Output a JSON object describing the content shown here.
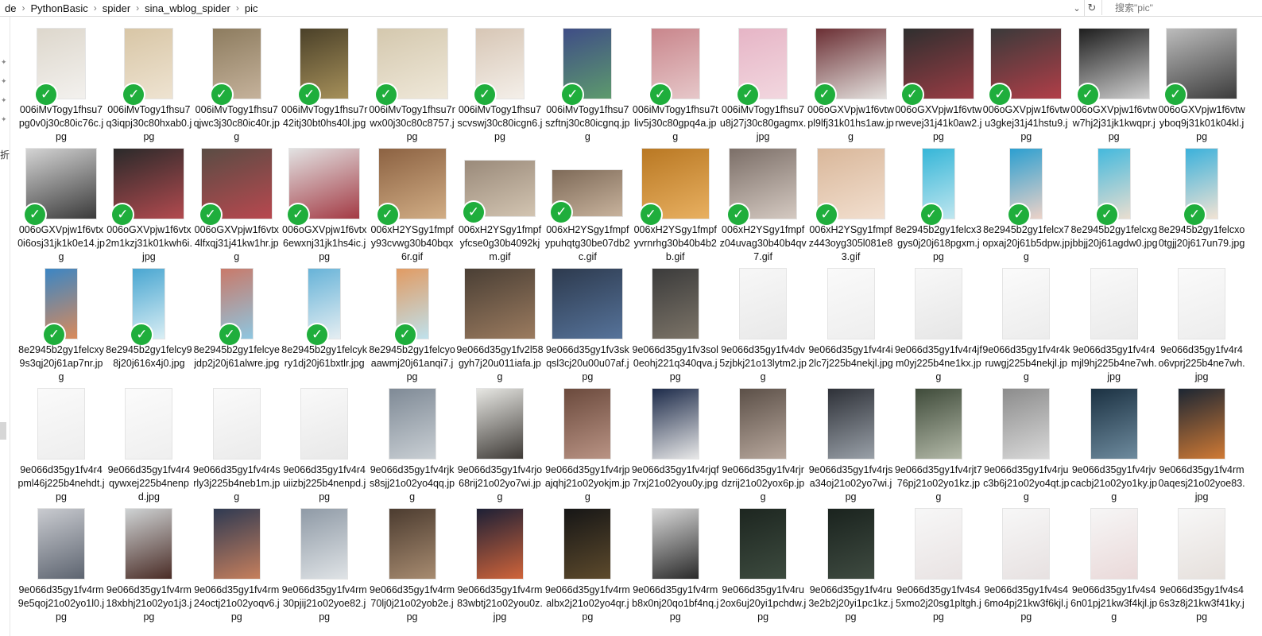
{
  "address": {
    "crumbs": [
      "de",
      "PythonBasic",
      "spider",
      "sina_wblog_spider",
      "pic"
    ],
    "separator": "›",
    "dropdown_glyph": "⌄",
    "refresh_glyph": "↻",
    "search_placeholder": "搜索\"pic\""
  },
  "left_pane": {
    "text": "折"
  },
  "files": [
    {
      "name": "006iMvTogy1fhsu7pg0v0j30c80ic76c.jpg",
      "checked": true,
      "colors": [
        "#ddd7cc",
        "#f3f1ee"
      ]
    },
    {
      "name": "006iMvTogy1fhsu7q3iqpj30c80hxab0.jpg",
      "checked": true,
      "colors": [
        "#d8c6a6",
        "#eee3d1"
      ]
    },
    {
      "name": "006iMvTogy1fhsu7qjwc3j30c80ic40r.jpg",
      "checked": true,
      "colors": [
        "#8d7c5f",
        "#c5b29b"
      ]
    },
    {
      "name": "006iMvTogy1fhsu7r42itj30bt0hs40l.jpg",
      "checked": true,
      "colors": [
        "#4b4129",
        "#a6905a"
      ]
    },
    {
      "name": "006iMvTogy1fhsu7rwx00j30c80c8757.jpg",
      "checked": true,
      "colors": [
        "#d4c8ae",
        "#efe8d9"
      ]
    },
    {
      "name": "006iMvTogy1fhsu7scvswj30c80icgn6.jpg",
      "checked": true,
      "colors": [
        "#d7c6b5",
        "#f4efe9"
      ]
    },
    {
      "name": "006iMvTogy1fhsu7szftnj30c80icgnq.jpg",
      "checked": true,
      "colors": [
        "#3f4d86",
        "#5d9a6d"
      ]
    },
    {
      "name": "006iMvTogy1fhsu7tliv5j30c80gpq4a.jpg",
      "checked": true,
      "colors": [
        "#c9868c",
        "#e6c7c9"
      ]
    },
    {
      "name": "006iMvTogy1fhsu7u8j27j30c80gagmx.jpg",
      "checked": true,
      "colors": [
        "#e6b5c6",
        "#f2d7df"
      ]
    },
    {
      "name": "006oGXVpjw1f6vtwpl9lfj31k01hs1aw.jpg",
      "checked": true,
      "colors": [
        "#6b2f34",
        "#e4e1de"
      ]
    },
    {
      "name": "006oGXVpjw1f6vtwrwevej31j41k0aw2.jpg",
      "checked": true,
      "colors": [
        "#2f2f2f",
        "#9a3c44"
      ]
    },
    {
      "name": "006oGXVpjw1f6vtwu3gkej31j41hstu9.jpg",
      "checked": true,
      "colors": [
        "#3a3a3a",
        "#b13e48"
      ]
    },
    {
      "name": "006oGXVpjw1f6vtww7hj2j31jk1kwqpr.jpg",
      "checked": true,
      "colors": [
        "#1e1e1e",
        "#cfcfcf"
      ]
    },
    {
      "name": "006oGXVpjw1f6vtwyboq9j31k01k04kl.jpg",
      "checked": true,
      "colors": [
        "#bcbcbc",
        "#3c3c3c"
      ]
    },
    {
      "name": "006oGXVpjw1f6vtx0i6osj31jk1k0e14.jpg",
      "checked": true,
      "colors": [
        "#d4d4d4",
        "#3a3a3a"
      ]
    },
    {
      "name": "006oGXVpjw1f6vtx2m1kzj31k01kwh6i.jpg",
      "checked": true,
      "colors": [
        "#2a2a2a",
        "#b24a4f"
      ]
    },
    {
      "name": "006oGXVpjw1f6vtx4lfxqj31j41kw1hr.jpg",
      "checked": true,
      "colors": [
        "#5a4c44",
        "#b8484f"
      ]
    },
    {
      "name": "006oGXVpjw1f6vtx6ewxnj31jk1hs4ic.jpg",
      "checked": true,
      "colors": [
        "#e2e2e2",
        "#a33a44"
      ]
    },
    {
      "name": "006xH2YSgy1fmpfy93cvwg30b40bqx6r.gif",
      "checked": true,
      "colors": [
        "#8c6242",
        "#d1ad85"
      ]
    },
    {
      "name": "006xH2YSgy1fmpfyfcse0g30b4092kjm.gif",
      "checked": true,
      "colors": [
        "#9a8a7a",
        "#d2c4b1"
      ]
    },
    {
      "name": "006xH2YSgy1fmpfypuhqtg30be07db2c.gif",
      "checked": true,
      "colors": [
        "#7e6a58",
        "#c7b29c"
      ]
    },
    {
      "name": "006xH2YSgy1fmpfyvrnrhg30b40b4b2b.gif",
      "checked": true,
      "colors": [
        "#b97823",
        "#e8b061"
      ]
    },
    {
      "name": "006xH2YSgy1fmpfz04uvag30b40b4qv7.gif",
      "checked": true,
      "colors": [
        "#7c6f68",
        "#d4c9c1"
      ]
    },
    {
      "name": "006xH2YSgy1fmpfz443oyg305l081e83.gif",
      "checked": true,
      "colors": [
        "#d9b79a",
        "#f2dfcf"
      ]
    },
    {
      "name": "8e2945b2gy1felcx3gys0j20j618pgxm.jpg",
      "checked": true,
      "colors": [
        "#36b6d8",
        "#bfe6ef"
      ]
    },
    {
      "name": "8e2945b2gy1felcx7opxaj20j61b5dpw.jpg",
      "checked": true,
      "colors": [
        "#2c9fd0",
        "#ecd2c8"
      ]
    },
    {
      "name": "8e2945b2gy1felcxgjbbjj20j61agdw0.jpg",
      "checked": true,
      "colors": [
        "#44b9dd",
        "#e9ded0"
      ]
    },
    {
      "name": "8e2945b2gy1felcxo0tgjj20j617un79.jpg",
      "checked": true,
      "colors": [
        "#3bb1db",
        "#f2e3d4"
      ]
    },
    {
      "name": "8e2945b2gy1felcxy9s3qj20j61ap7nr.jpg",
      "checked": true,
      "colors": [
        "#3b86c4",
        "#d98a5b"
      ]
    },
    {
      "name": "8e2945b2gy1felcy98j20j616x4j0.jpg",
      "checked": true,
      "colors": [
        "#49a6d1",
        "#d9eef4"
      ]
    },
    {
      "name": "8e2945b2gy1felcyejdp2j20j61alwre.jpg",
      "checked": true,
      "colors": [
        "#c97969",
        "#8ec6e0"
      ]
    },
    {
      "name": "8e2945b2gy1felcykry1dj20j61bxtlr.jpg",
      "checked": true,
      "colors": [
        "#67b3d8",
        "#e5eef2"
      ]
    },
    {
      "name": "8e2945b2gy1felcyoaawmj20j61anqi7.jpg",
      "checked": true,
      "colors": [
        "#e19b63",
        "#bfe1ec"
      ]
    },
    {
      "name": "9e066d35gy1fv2l58gyh7j20u011iafa.jpg",
      "checked": false,
      "colors": [
        "#4a3f35",
        "#9b7b5f"
      ]
    },
    {
      "name": "9e066d35gy1fv3skqsl3cj20u00u07af.jpg",
      "checked": false,
      "colors": [
        "#2d3a4e",
        "#56739a"
      ]
    },
    {
      "name": "9e066d35gy1fv3sol0eohj221q340qva.jpg",
      "checked": false,
      "colors": [
        "#3b3b3b",
        "#7c7468"
      ]
    },
    {
      "name": "9e066d35gy1fv4dv5zjbkj21o13lytm2.jpg",
      "checked": false,
      "colors": [
        "#f7f7f7",
        "#e9e9e9"
      ]
    },
    {
      "name": "9e066d35gy1fv4r4i2lc7j225b4nekjl.jpg",
      "checked": false,
      "colors": [
        "#fafafa",
        "#eeeeee"
      ]
    },
    {
      "name": "9e066d35gy1fv4r4jfm0yj225b4ne1kx.jpg",
      "checked": false,
      "colors": [
        "#f8f8f8",
        "#e6e6e6"
      ]
    },
    {
      "name": "9e066d35gy1fv4r4kruwgj225b4nekjl.jpg",
      "checked": false,
      "colors": [
        "#fbfbfb",
        "#ececec"
      ]
    },
    {
      "name": "9e066d35gy1fv4r4mjl9hj225b4ne7wh.jpg",
      "checked": false,
      "colors": [
        "#f9f9f9",
        "#eaeaea"
      ]
    },
    {
      "name": "9e066d35gy1fv4r4o6vprj225b4ne7wh.jpg",
      "checked": false,
      "colors": [
        "#fafafa",
        "#ededed"
      ]
    },
    {
      "name": "9e066d35gy1fv4r4pml46j225b4nehdt.jpg",
      "checked": false,
      "colors": [
        "#fafafa",
        "#eeeeee"
      ]
    },
    {
      "name": "9e066d35gy1fv4r4qywxej225b4nenpd.jpg",
      "checked": false,
      "colors": [
        "#fbfbfb",
        "#efefef"
      ]
    },
    {
      "name": "9e066d35gy1fv4r4srly3j225b4neb1m.jpg",
      "checked": false,
      "colors": [
        "#fafafa",
        "#ebebeb"
      ]
    },
    {
      "name": "9e066d35gy1fv4r4uiizbj225b4nenpd.jpg",
      "checked": false,
      "colors": [
        "#f9f9f9",
        "#e8e8e8"
      ]
    },
    {
      "name": "9e066d35gy1fv4rjks8sjj21o02yo4qq.jpg",
      "checked": false,
      "colors": [
        "#7f8a96",
        "#c9cfd4"
      ]
    },
    {
      "name": "9e066d35gy1fv4rjo68rij21o02yo7wi.jpg",
      "checked": false,
      "colors": [
        "#e7e7e3",
        "#3e3a36"
      ]
    },
    {
      "name": "9e066d35gy1fv4rjpajqhj21o02yokjm.jpg",
      "checked": false,
      "colors": [
        "#6b4a3d",
        "#b99384"
      ]
    },
    {
      "name": "9e066d35gy1fv4rjqf7rxj21o02you0y.jpg",
      "checked": false,
      "colors": [
        "#1d2b4a",
        "#e8e8e8"
      ]
    },
    {
      "name": "9e066d35gy1fv4rjrdzrij21o02yox6p.jpg",
      "checked": false,
      "colors": [
        "#5c5048",
        "#b7a79c"
      ]
    },
    {
      "name": "9e066d35gy1fv4rjsa34oj21o02yo7wi.jpg",
      "checked": false,
      "colors": [
        "#2e3138",
        "#99a0a8"
      ]
    },
    {
      "name": "9e066d35gy1fv4rjt776pj21o02yo1kz.jpg",
      "checked": false,
      "colors": [
        "#3f4b3a",
        "#b3b9a8"
      ]
    },
    {
      "name": "9e066d35gy1fv4rjuc3b6j21o02yo4qt.jpg",
      "checked": false,
      "colors": [
        "#8c8c8c",
        "#d9d9d9"
      ]
    },
    {
      "name": "9e066d35gy1fv4rjvcacbj21o02yo1ky.jpg",
      "checked": false,
      "colors": [
        "#1b3142",
        "#6e8b9e"
      ]
    },
    {
      "name": "9e066d35gy1fv4rm0aqesj21o02yoe83.jpg",
      "checked": false,
      "colors": [
        "#1c2633",
        "#d07a35"
      ]
    },
    {
      "name": "9e066d35gy1fv4rm9e5qoj21o02yo1l0.jpg",
      "checked": false,
      "colors": [
        "#c9cbd0",
        "#5d6470"
      ]
    },
    {
      "name": "9e066d35gy1fv4rm18xbhj21o02yo1j3.jpg",
      "checked": false,
      "colors": [
        "#cfd3d4",
        "#4a2c26"
      ]
    },
    {
      "name": "9e066d35gy1fv4rm24octj21o02yoqv6.jpg",
      "checked": false,
      "colors": [
        "#2f3a52",
        "#c67f5d"
      ]
    },
    {
      "name": "9e066d35gy1fv4rm30pjij21o02yoe82.jpg",
      "checked": false,
      "colors": [
        "#8f9aa6",
        "#dfe3e6"
      ]
    },
    {
      "name": "9e066d35gy1fv4rm70lj0j21o02yob2e.jpg",
      "checked": false,
      "colors": [
        "#4c3c30",
        "#a78b70"
      ]
    },
    {
      "name": "9e066d35gy1fv4rm83wbtj21o02you0z.jpg",
      "checked": false,
      "colors": [
        "#1d2036",
        "#d0643a"
      ]
    },
    {
      "name": "9e066d35gy1fv4rmalbx2j21o02yo4qr.jpg",
      "checked": false,
      "colors": [
        "#161616",
        "#5d4a2c"
      ]
    },
    {
      "name": "9e066d35gy1fv4rmb8x0nj20qo1bf4nq.jpg",
      "checked": false,
      "colors": [
        "#d7d7d7",
        "#2a2a2a"
      ]
    },
    {
      "name": "9e066d35gy1fv4ru2ox6uj20yi1pchdw.jpg",
      "checked": false,
      "colors": [
        "#1d2620",
        "#3d4b3f"
      ]
    },
    {
      "name": "9e066d35gy1fv4ru3e2b2j20yi1pc1kz.jpg",
      "checked": false,
      "colors": [
        "#1a231e",
        "#3f4b41"
      ]
    },
    {
      "name": "9e066d35gy1fv4s45xmo2j20sg1pltgh.jpg",
      "checked": false,
      "colors": [
        "#f7f7f7",
        "#e9e3e3"
      ]
    },
    {
      "name": "9e066d35gy1fv4s46mo4pj21kw3f6kjl.jpg",
      "checked": false,
      "colors": [
        "#f7f7f7",
        "#e7e1e1"
      ]
    },
    {
      "name": "9e066d35gy1fv4s46n01pj21kw3f4kjl.jpg",
      "checked": false,
      "colors": [
        "#f6f6f6",
        "#ead9d9"
      ]
    },
    {
      "name": "9e066d35gy1fv4s46s3z8j21kw3f41ky.jpg",
      "checked": false,
      "colors": [
        "#f7f7f7",
        "#e6e0dc"
      ]
    }
  ]
}
